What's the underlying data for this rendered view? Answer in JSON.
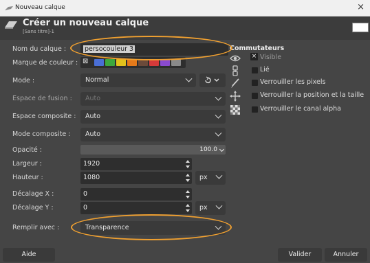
{
  "window": {
    "title": "Nouveau calque",
    "close_glyph": "×"
  },
  "header": {
    "title": "Créer un nouveau calque",
    "subtitle": "[Sans titre]-1"
  },
  "form": {
    "name_label": "Nom du calque :",
    "name_value": "persocouleur 3",
    "color_tag_label": "Marque de couleur :",
    "color_tags": [
      "#4a6fd6",
      "#3da83d",
      "#e2c21c",
      "#e57a1a",
      "#6b4a3a",
      "#d43a3a",
      "#8a4ad0",
      "#8a8a8a"
    ],
    "mode_label": "Mode :",
    "mode_value": "Normal",
    "blend_space_label": "Espace de fusion :",
    "blend_space_value": "Auto",
    "composite_space_label": "Espace composite :",
    "composite_space_value": "Auto",
    "composite_mode_label": "Mode composite :",
    "composite_mode_value": "Auto",
    "opacity_label": "Opacité :",
    "opacity_value": "100.0",
    "width_label": "Largeur :",
    "width_value": "1920",
    "height_label": "Hauteur :",
    "height_value": "1080",
    "size_unit": "px",
    "offset_x_label": "Décalage X :",
    "offset_x_value": "0",
    "offset_y_label": "Décalage Y :",
    "offset_y_value": "0",
    "offset_unit": "px",
    "fill_label": "Remplir avec :",
    "fill_value": "Transparence"
  },
  "switches": {
    "title": "Commutateurs",
    "items": [
      {
        "label": "Visible",
        "checked": true,
        "icon": "eye-icon"
      },
      {
        "label": "Lié",
        "checked": false,
        "icon": "chain-icon"
      },
      {
        "label": "Verrouiller les pixels",
        "checked": false,
        "icon": "brush-icon"
      },
      {
        "label": "Verrouiller la position et la taille",
        "checked": false,
        "icon": "move-icon"
      },
      {
        "label": "Verrouiller le canal alpha",
        "checked": false,
        "icon": "checker-icon"
      }
    ]
  },
  "buttons": {
    "help": "Aide",
    "ok": "Valider",
    "cancel": "Annuler"
  },
  "colors": {
    "highlight": "#f0a030",
    "background": "#454545"
  }
}
